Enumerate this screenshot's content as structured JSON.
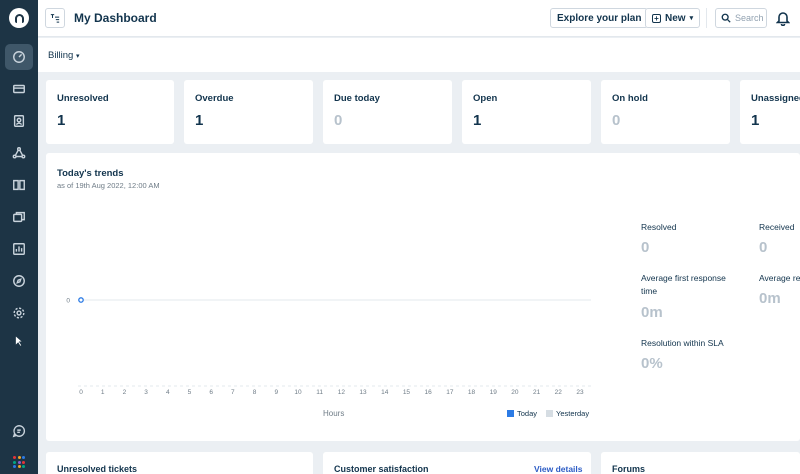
{
  "header": {
    "title": "My Dashboard",
    "explore_label": "Explore your plan",
    "new_label": "New",
    "search_placeholder": "Search"
  },
  "subheader": {
    "billing_label": "Billing"
  },
  "stats": [
    {
      "label": "Unresolved",
      "value": "1",
      "muted": false
    },
    {
      "label": "Overdue",
      "value": "1",
      "muted": false
    },
    {
      "label": "Due today",
      "value": "0",
      "muted": true
    },
    {
      "label": "Open",
      "value": "1",
      "muted": false
    },
    {
      "label": "On hold",
      "value": "0",
      "muted": true
    },
    {
      "label": "Unassigned",
      "value": "1",
      "muted": false
    }
  ],
  "trends": {
    "title": "Today's trends",
    "subtitle": "as of 19th Aug 2022, 12:00 AM",
    "xlabel": "Hours",
    "legend_today": "Today",
    "legend_yesterday": "Yesterday"
  },
  "metrics": {
    "resolved_label": "Resolved",
    "resolved_value": "0",
    "received_label": "Received",
    "received_value": "0",
    "afr_label": "Average first response time",
    "afr_value": "0m",
    "avg_re_label": "Average re",
    "avg_re_value": "0m",
    "sla_label": "Resolution within SLA",
    "sla_value": "0%"
  },
  "bottom": {
    "unresolved_title": "Unresolved tickets",
    "csat_title": "Customer satisfaction",
    "csat_link": "View details",
    "forums_title": "Forums"
  },
  "chart_data": {
    "type": "line",
    "x": [
      0,
      1,
      2,
      3,
      4,
      5,
      6,
      7,
      8,
      9,
      10,
      11,
      12,
      13,
      14,
      15,
      16,
      17,
      18,
      19,
      20,
      21,
      22,
      23
    ],
    "series": [
      {
        "name": "Today",
        "values": [
          0
        ]
      },
      {
        "name": "Yesterday",
        "values": []
      }
    ],
    "y_ticks": [
      "0"
    ],
    "xlabel": "Hours",
    "colors": {
      "today": "#2c7be5",
      "yesterday": "#d6dde3"
    }
  },
  "icons": {
    "sidebar": [
      "dashboard-icon",
      "tickets-icon",
      "contacts-icon",
      "social-icon",
      "solutions-icon",
      "forums-icon",
      "reports-icon",
      "discussions-icon",
      "admin-icon",
      "cursor-icon",
      "chat-icon",
      "apps-icon"
    ]
  },
  "colors": {
    "sidebar": "#1d3445",
    "accent": "#2c7be5",
    "link": "#2c5cc5"
  }
}
